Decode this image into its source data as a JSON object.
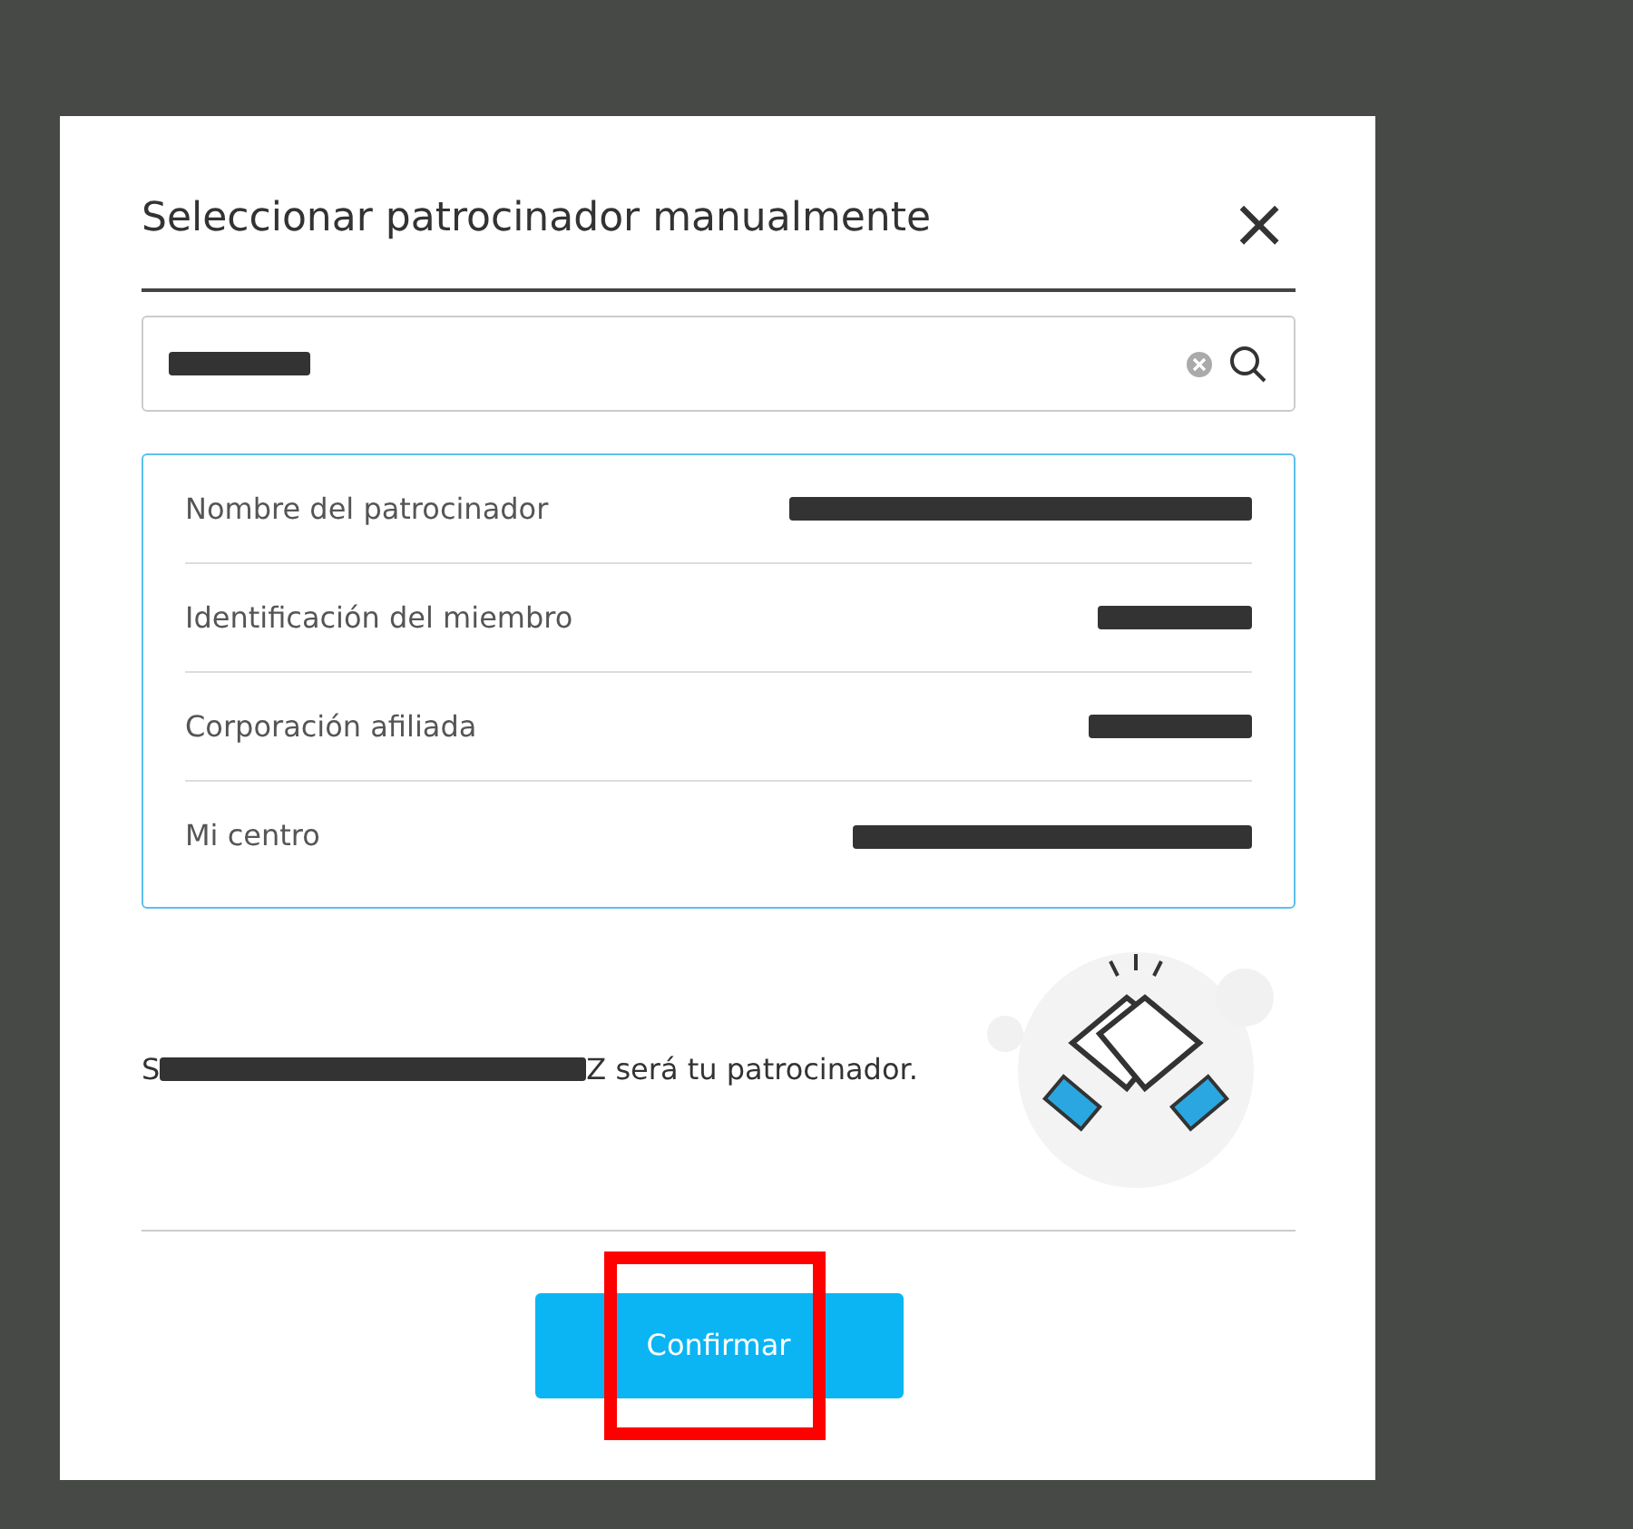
{
  "dialog": {
    "title": "Seleccionar patrocinador manualmente",
    "close_icon": "×"
  },
  "search": {
    "value_redacted": true
  },
  "sponsor_rows": [
    {
      "label": "Nombre del patrocinador",
      "value_redacted": true
    },
    {
      "label": "Identificación del miembro",
      "value_redacted": true
    },
    {
      "label": "Corporación afiliada",
      "value_redacted": true
    },
    {
      "label": "Mi centro",
      "value_redacted": true
    }
  ],
  "message": {
    "start": "S",
    "end": "Z será tu patrocinador.",
    "middle_redacted": true
  },
  "confirm_button": {
    "label": "Confirmar"
  },
  "annotation": {
    "kind": "highlight-box",
    "color": "#ff0000"
  }
}
